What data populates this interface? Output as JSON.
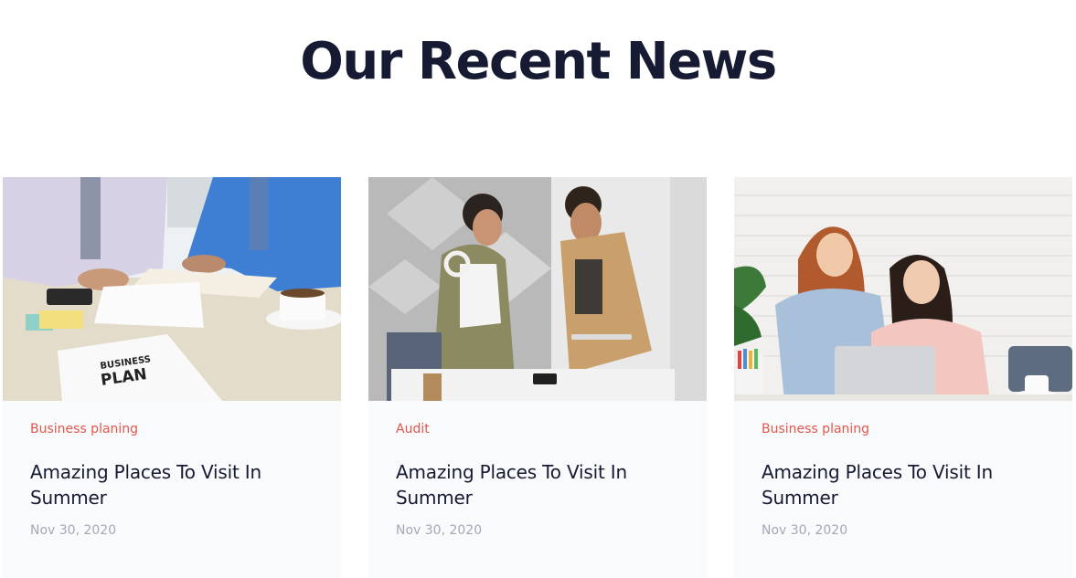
{
  "section": {
    "title": "Our Recent News"
  },
  "posts": [
    {
      "category": "Business planing",
      "title": "Amazing Places To Visit In Summer",
      "date": "Nov 30, 2020",
      "image_label": "BUSINESS PLAN"
    },
    {
      "category": "Audit",
      "title": "Amazing Places To Visit In Summer",
      "date": "Nov 30, 2020"
    },
    {
      "category": "Business planing",
      "title": "Amazing Places To Visit In Summer",
      "date": "Nov 30, 2020"
    }
  ],
  "colors": {
    "heading": "#161b33",
    "category": "#e2574c",
    "date": "#a3a8b8",
    "card_bg": "#f9fafc"
  }
}
